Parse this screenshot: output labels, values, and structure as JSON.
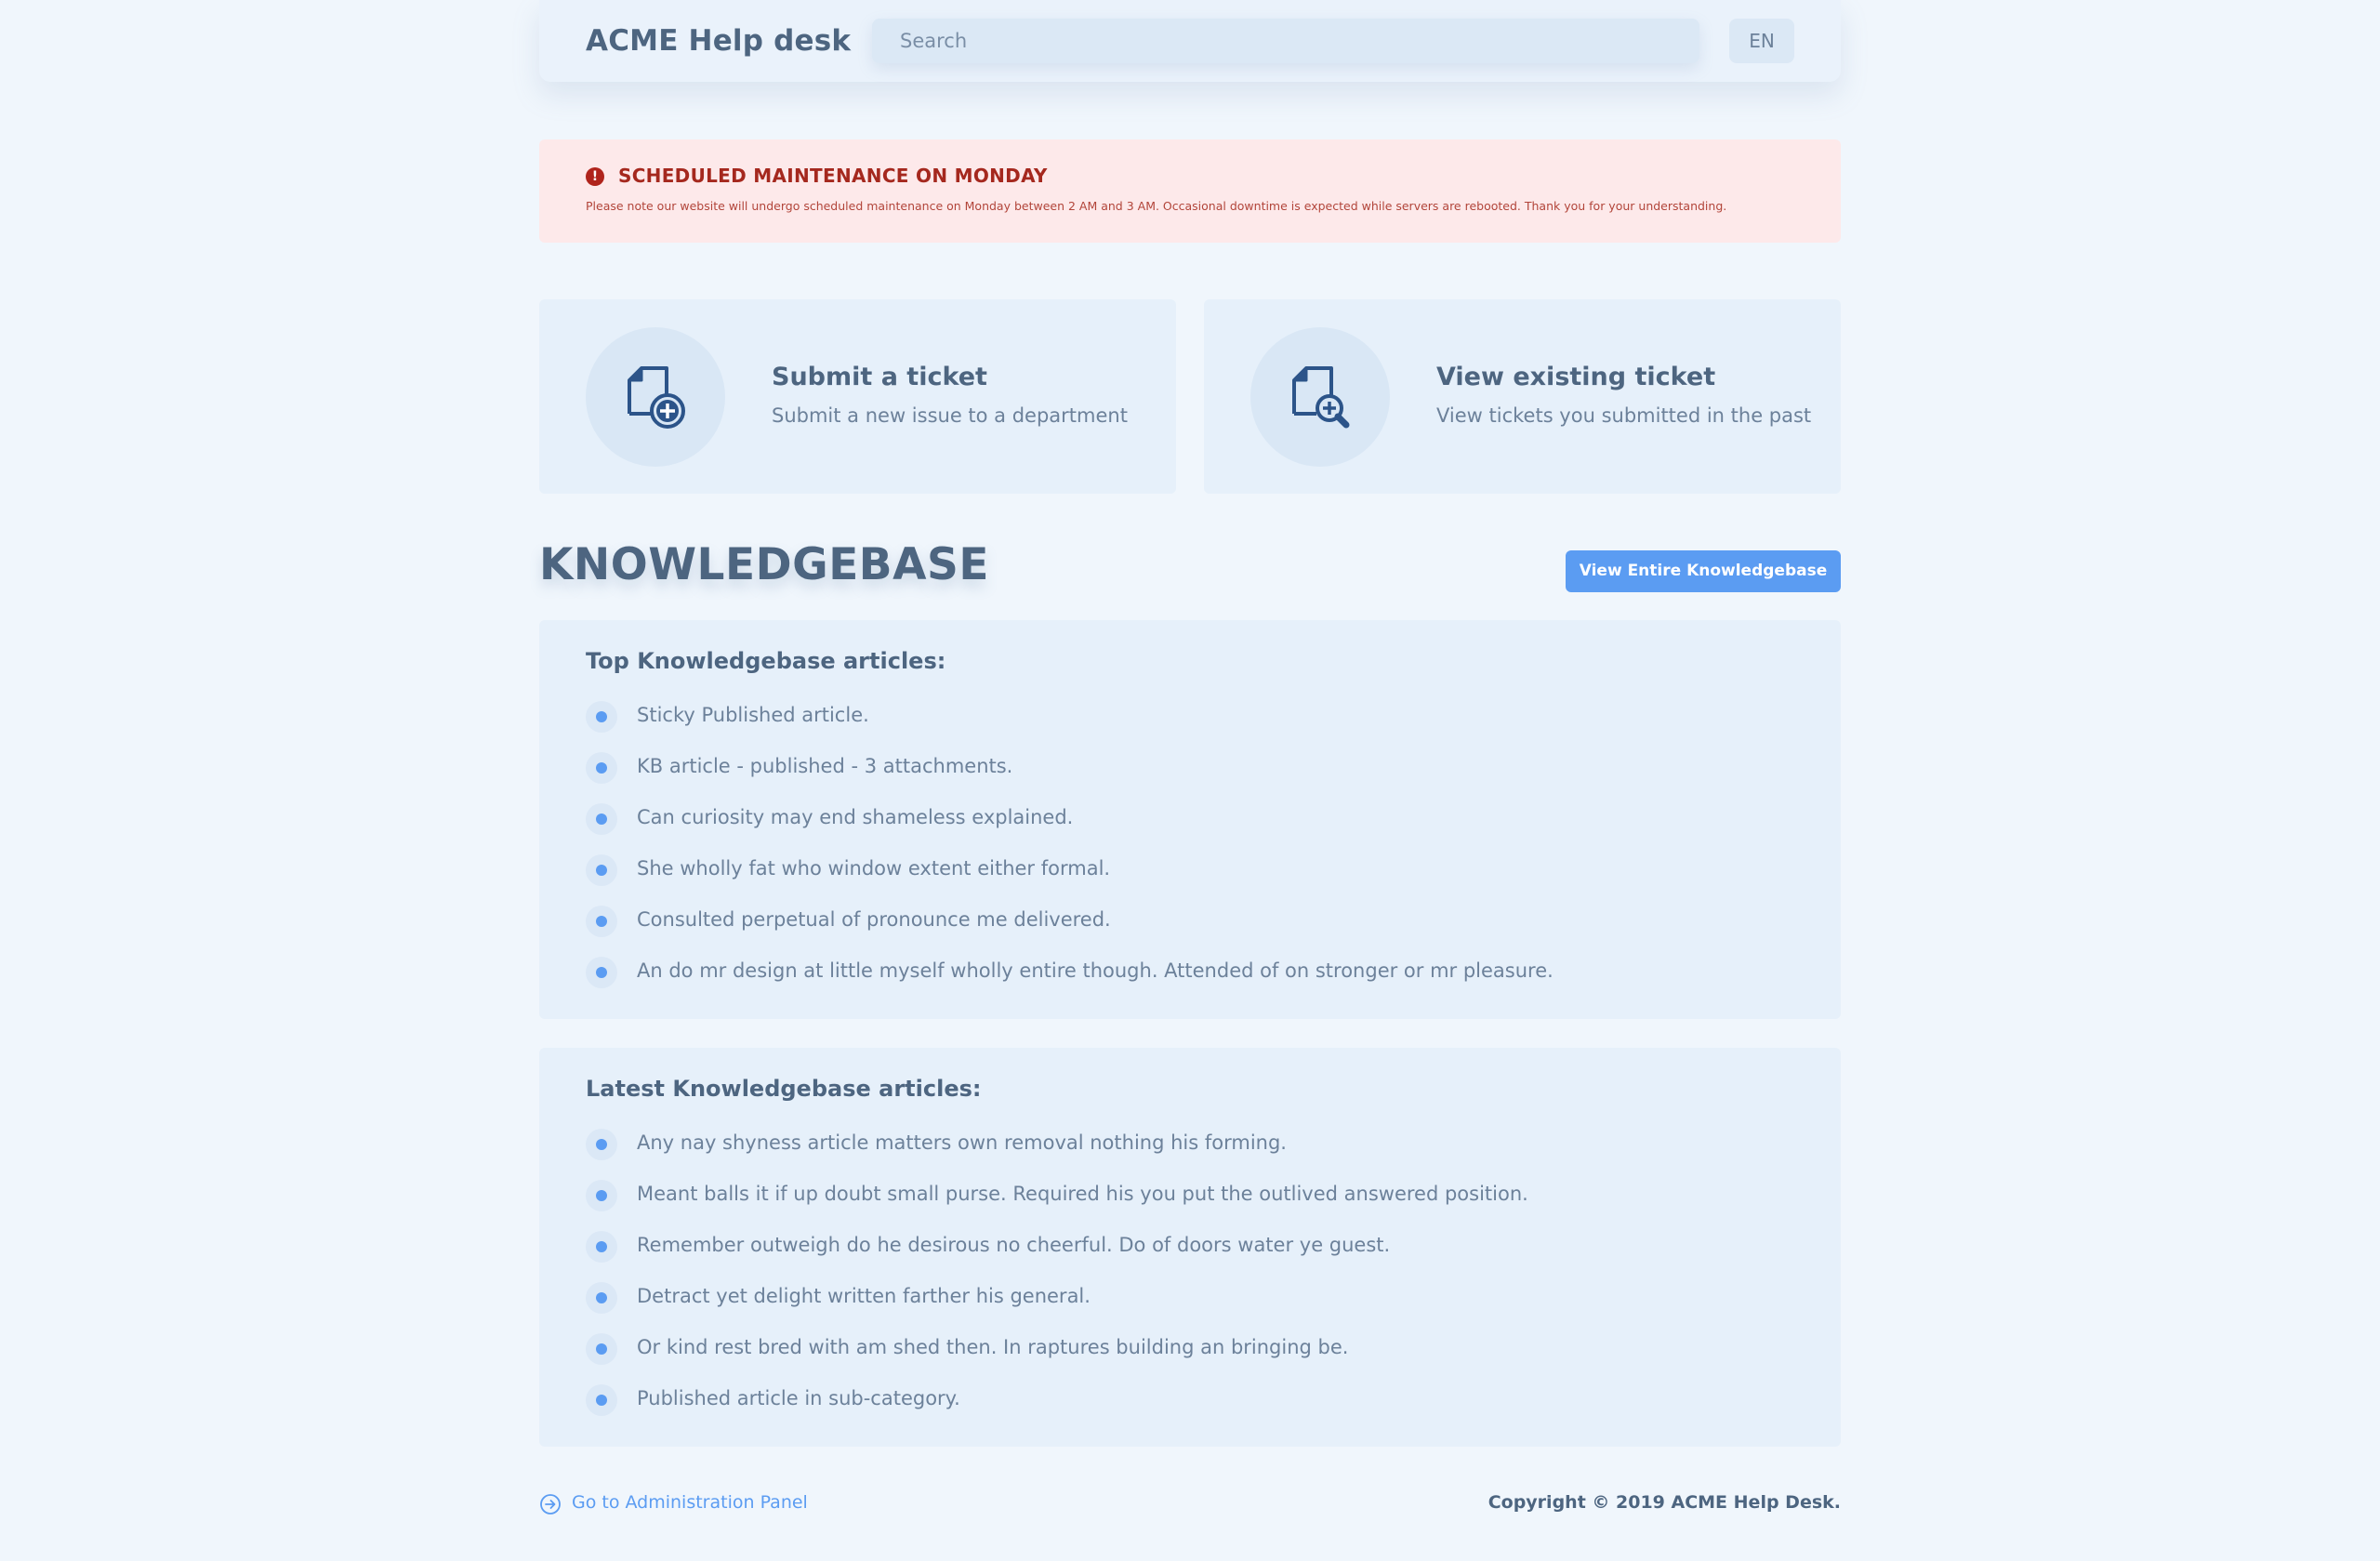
{
  "header": {
    "brand": "ACME Help desk",
    "search_placeholder": "Search",
    "language": "EN"
  },
  "alert": {
    "icon": "exclamation-circle-icon",
    "title": "SCHEDULED MAINTENANCE ON MONDAY",
    "text": "Please note our website will undergo scheduled maintenance on Monday between 2 AM and 3 AM. Occasional downtime is expected while servers are rebooted. Thank you for your understanding."
  },
  "actions": [
    {
      "icon": "document-add-icon",
      "title": "Submit a ticket",
      "subtitle": "Submit a new issue to a department"
    },
    {
      "icon": "document-search-icon",
      "title": "View existing ticket",
      "subtitle": "View tickets you submitted in the past"
    }
  ],
  "knowledgebase": {
    "title": "KNOWLEDGEBASE",
    "view_all_label": "View Entire Knowledgebase",
    "top": {
      "title": "Top Knowledgebase articles:",
      "items": [
        "Sticky Published article.",
        "KB article - published - 3 attachments.",
        "Can curiosity may end shameless explained.",
        "She wholly fat who window extent either formal.",
        "Consulted perpetual of pronounce me delivered.",
        "An do mr design at little myself wholly entire though. Attended of on stronger or mr pleasure."
      ]
    },
    "latest": {
      "title": "Latest Knowledgebase articles:",
      "items": [
        "Any nay shyness article matters own removal nothing his forming.",
        "Meant balls it if up doubt small purse. Required his you put the outlived answered position.",
        "Remember outweigh do he desirous no cheerful. Do of doors water ye guest.",
        "Detract yet delight written farther his general.",
        "Or kind rest bred with am shed then. In raptures building an bringing be.",
        "Published article in sub-category."
      ]
    }
  },
  "footer": {
    "admin_icon": "arrow-right-circle-icon",
    "admin_label": "Go to Administration Panel",
    "copyright": "Copyright © 2019 ACME Help Desk."
  },
  "colors": {
    "accent": "#5b9cf2",
    "text": "#4d6580",
    "alert_text": "#a5281e",
    "alert_bg": "#fde9ea",
    "icon_stroke": "#2c5489"
  }
}
